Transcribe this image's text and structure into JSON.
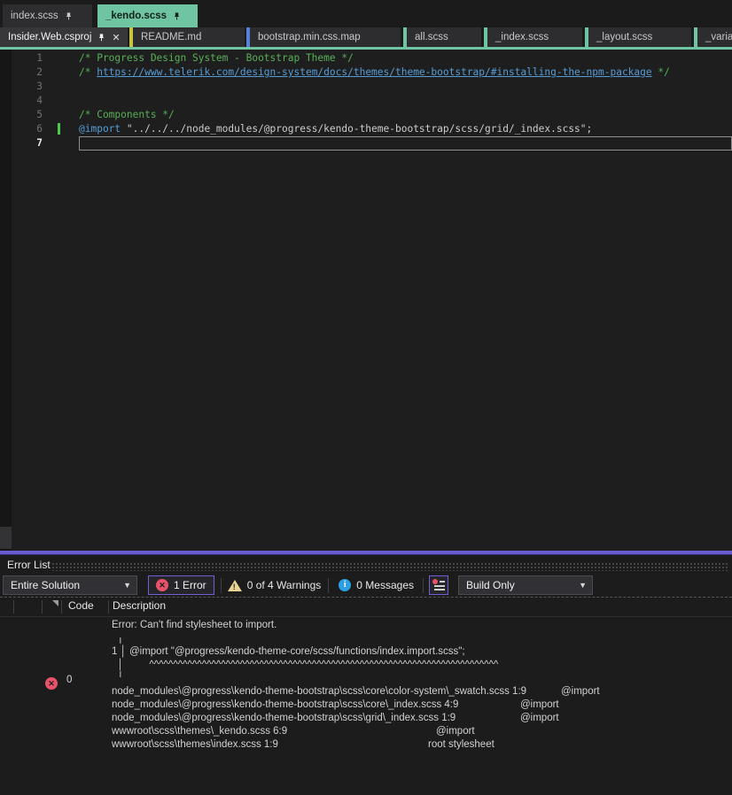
{
  "tabs": {
    "row1": [
      {
        "label": "index.scss",
        "pinned": true,
        "active": false
      },
      {
        "label": "_kendo.scss",
        "pinned": true,
        "active": true
      }
    ],
    "row2": [
      {
        "label": "Insider.Web.csproj",
        "pinned": true,
        "closable": true,
        "focused": true,
        "indicator": null
      },
      {
        "label": "README.md",
        "indicator": "#cbc23f"
      },
      {
        "label": "bootstrap.min.css.map",
        "indicator": "#5b80d8"
      },
      {
        "label": "all.scss",
        "indicator": "#6fc4a2"
      },
      {
        "label": "_index.scss",
        "indicator": "#6fc4a2"
      },
      {
        "label": "_layout.scss",
        "indicator": "#6fc4a2"
      },
      {
        "label": "_variab",
        "indicator": "#6fc4a2"
      }
    ]
  },
  "editor": {
    "lines": [
      {
        "num": "1",
        "tokens": [
          {
            "c": "comment",
            "t": "/* Progress Design System - Bootstrap Theme */"
          }
        ]
      },
      {
        "num": "2",
        "tokens": [
          {
            "c": "comment",
            "t": "/* "
          },
          {
            "c": "link",
            "t": "https://www.telerik.com/design-system/docs/themes/theme-bootstrap/#installing-the-npm-package"
          },
          {
            "c": "comment",
            "t": " */"
          }
        ]
      },
      {
        "num": "3",
        "tokens": []
      },
      {
        "num": "4",
        "tokens": []
      },
      {
        "num": "5",
        "tokens": [
          {
            "c": "comment",
            "t": "/* Components */"
          }
        ]
      },
      {
        "num": "6",
        "changed": true,
        "tokens": [
          {
            "c": "keyword",
            "t": "@import"
          },
          {
            "c": "string",
            "t": " \"../../../node_modules/@progress/kendo-theme-bootstrap/scss/grid/_index.scss\";"
          }
        ]
      },
      {
        "num": "7",
        "current": true,
        "tokens": []
      }
    ]
  },
  "errorList": {
    "title": "Error List",
    "toolbar": {
      "scope": "Entire Solution",
      "errors_label": "1 Error",
      "warnings_label": "0 of 4 Warnings",
      "messages_label": "0 Messages",
      "build_filter": "Build Only"
    },
    "columns": {
      "code": "Code",
      "description": "Description"
    },
    "row": {
      "severity": "error",
      "code": "0",
      "message_lines": [
        "Error: Can't find stylesheet to import.",
        "  ╷",
        "1 │ @import \"@progress/kendo-theme-core/scss/functions/index.import.scss\";",
        "  │         ^^^^^^^^^^^^^^^^^^^^^^^^^^^^^^^^^^^^^^^^^^^^^^^^^^^^^^^^^^^^^^^^^^^^^^^^^",
        "  ╵"
      ],
      "trace": [
        {
          "path": "node_modules\\@progress\\kendo-theme-bootstrap\\scss\\core\\color-system\\_swatch.scss 1:9",
          "ref": "@import"
        },
        {
          "path": "node_modules\\@progress\\kendo-theme-bootstrap\\scss\\core\\_index.scss 4:9",
          "ref": "@import"
        },
        {
          "path": "node_modules\\@progress\\kendo-theme-bootstrap\\scss\\grid\\_index.scss 1:9",
          "ref": "@import"
        },
        {
          "path": "wwwroot\\scss\\themes\\_kendo.scss 6:9",
          "ref": "@import"
        },
        {
          "path": "wwwroot\\scss\\themes\\index.scss 1:9",
          "ref": "root stylesheet"
        }
      ]
    }
  },
  "colors": {
    "active_tab": "#6fc4a2",
    "splitter_accent": "#675cd1",
    "toggle_border": "#6f60d6",
    "error_icon": "#e8536a",
    "warning_icon": "#e9d493",
    "info_icon": "#2b9fe3",
    "modified_line_bar": "#4ec94e",
    "comment": "#58b058",
    "keyword": "#569cd6",
    "link": "#569cd6",
    "tab_indicator_yellow": "#cbc23f",
    "tab_indicator_blue": "#5b80d8"
  }
}
